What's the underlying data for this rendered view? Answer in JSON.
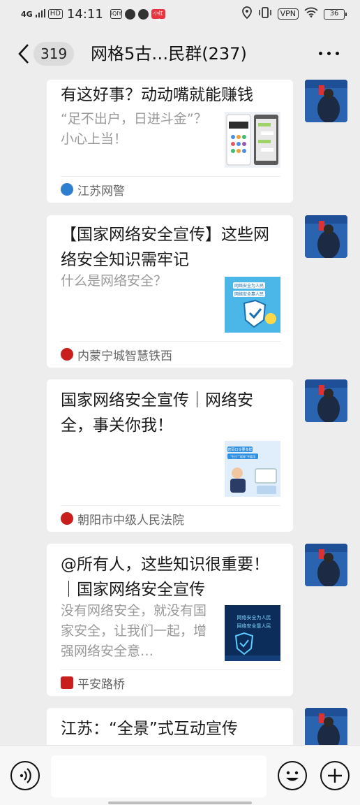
{
  "status_bar": {
    "network": "4G",
    "hd": "HD",
    "time": "14:11",
    "iqiyi": "iQIY",
    "red_app": "小红书",
    "vpn": "VPN",
    "battery": "36"
  },
  "header": {
    "unread_count": "319",
    "title": "网格5古…民群(237)"
  },
  "messages": [
    {
      "title": "有这好事？动动嘴就能赚钱",
      "desc": "“足不出户，日进斗金”？小心上当！",
      "source": "江苏网警",
      "source_color": "#2f7fd0"
    },
    {
      "title": "【国家网络安全宣传】这些网络安全知识需牢记",
      "desc": "什么是网络安全？",
      "source": "内蒙宁城智慧铁西",
      "source_color": "#c81e1e",
      "thumb_text": [
        "网络安全为人民",
        "网络安全靠人民"
      ]
    },
    {
      "title": "国家网络安全宣传｜网络安全，事关你我！",
      "desc": "",
      "source": "朝阳市中级人民法院",
      "source_color": "#c81e1e",
      "thumb_text": [
        "密码口令要多样",
        "“生日”“昵称”不要用"
      ]
    },
    {
      "title": "@所有人，这些知识很重要！｜国家网络安全宣传",
      "desc": "没有网络安全，就没有国家安全，让我们一起，增强网络安全意…",
      "source": "平安路桥",
      "source_color": "#c81e1e",
      "thumb_text": [
        "网络安全为人民",
        "网络安全靠人民"
      ]
    },
    {
      "title": "江苏：“全景”式互动宣传"
    }
  ],
  "input_bar": {
    "placeholder": ""
  }
}
